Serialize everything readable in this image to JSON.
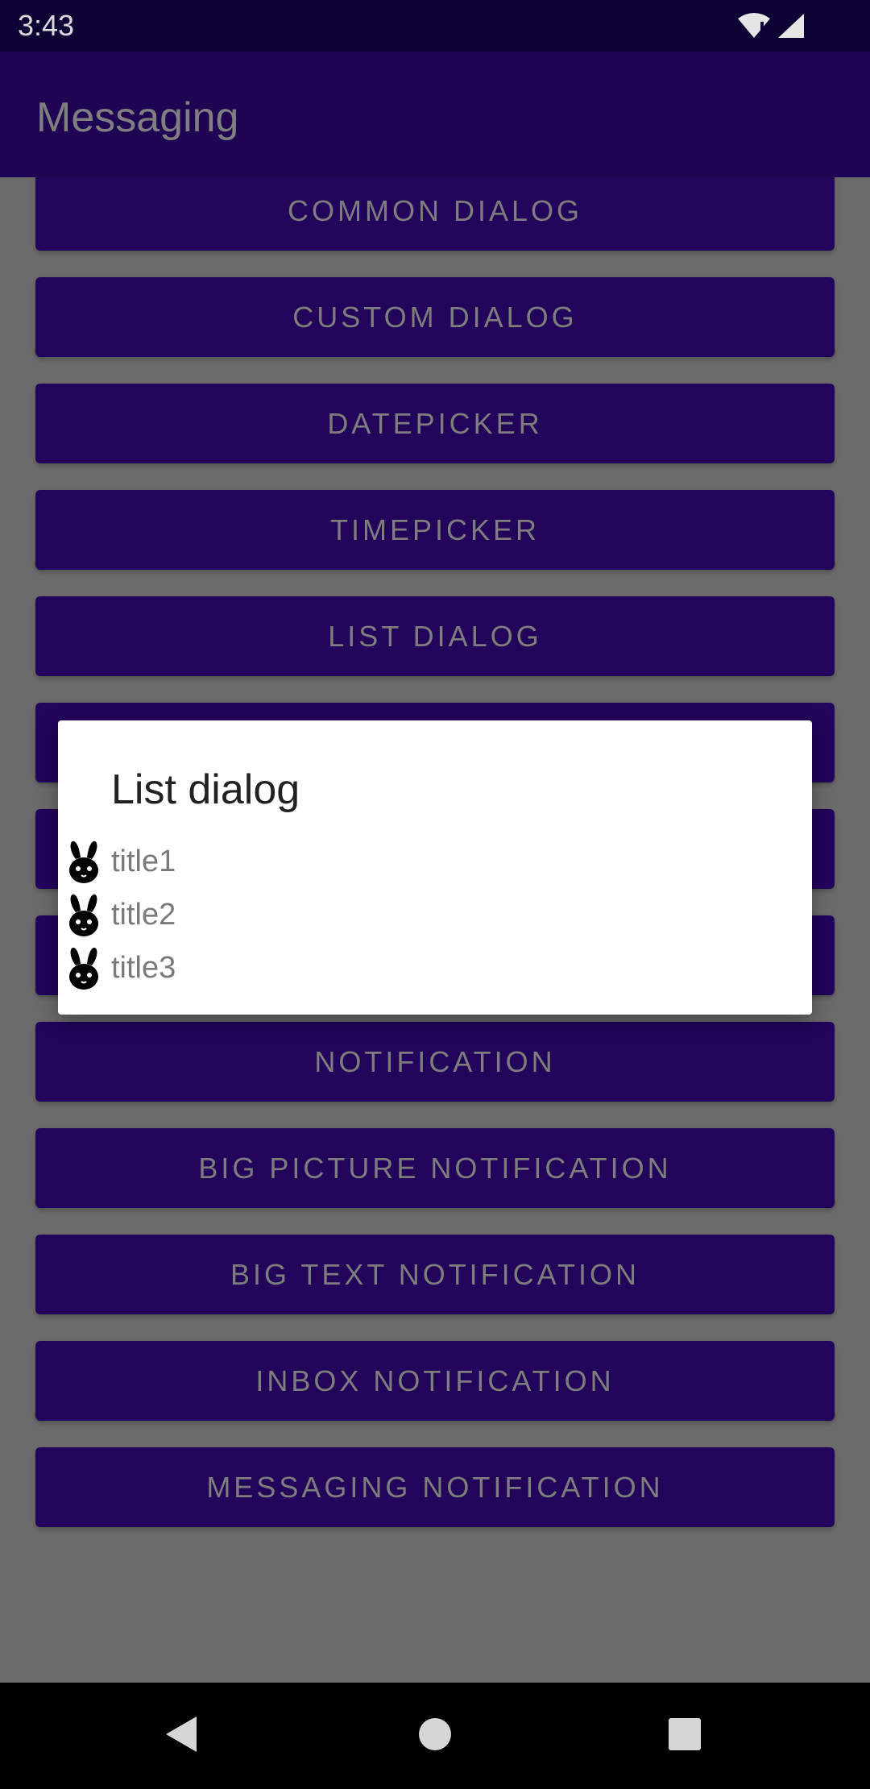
{
  "status_bar": {
    "time": "3:43",
    "icons": [
      "wifi-icon",
      "signal-icon"
    ]
  },
  "app_bar": {
    "title": "Messaging"
  },
  "buttons": [
    {
      "label": "COMMON DIALOG"
    },
    {
      "label": "CUSTOM DIALOG"
    },
    {
      "label": "DATEPICKER"
    },
    {
      "label": "TIMEPICKER"
    },
    {
      "label": "LIST DIALOG"
    },
    {
      "label": ""
    },
    {
      "label": ""
    },
    {
      "label": ""
    },
    {
      "label": "NOTIFICATION"
    },
    {
      "label": "BIG PICTURE NOTIFICATION"
    },
    {
      "label": "BIG TEXT NOTIFICATION"
    },
    {
      "label": "INBOX NOTIFICATION"
    },
    {
      "label": "MESSAGING NOTIFICATION"
    }
  ],
  "dialog": {
    "title": "List dialog",
    "items": [
      {
        "label": "title1",
        "icon": "bunny-icon"
      },
      {
        "label": "title2",
        "icon": "bunny-icon"
      },
      {
        "label": "title3",
        "icon": "bunny-icon"
      }
    ]
  },
  "nav_bar": {
    "icons": [
      "back-icon",
      "home-icon",
      "recents-icon"
    ]
  },
  "colors": {
    "app_bar": "#1f0453",
    "status_bar": "#0e0133",
    "button": "#22045a",
    "scrim_background": "#6b6b6b"
  }
}
